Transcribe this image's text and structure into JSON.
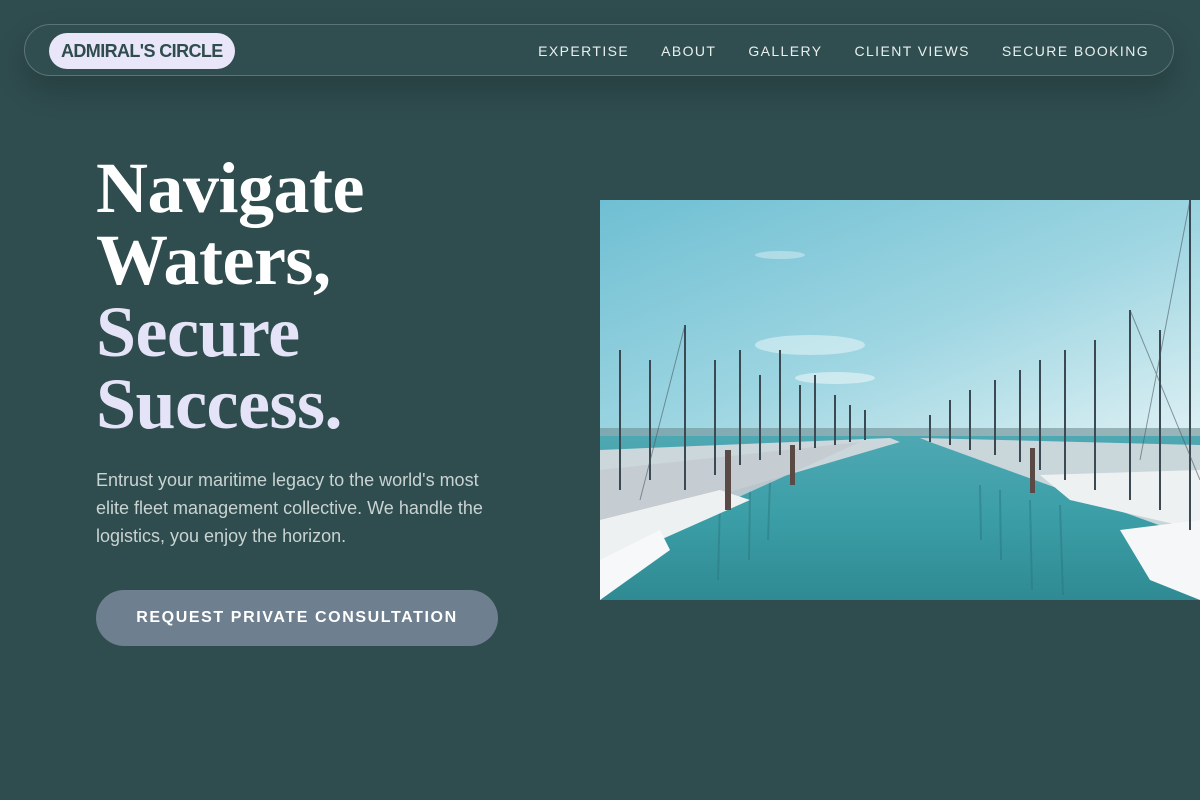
{
  "nav": {
    "brand": "ADMIRAL'S CIRCLE",
    "links": [
      "EXPERTISE",
      "ABOUT",
      "GALLERY",
      "CLIENT VIEWS",
      "SECURE BOOKING"
    ]
  },
  "hero": {
    "title_lines": [
      "Navigate",
      "Waters,",
      "Secure",
      "Success."
    ],
    "body": "Entrust your maritime legacy to the world's most elite fleet management collective. We handle the logistics, you enjoy the horizon.",
    "cta_label": "REQUEST PRIVATE CONSULTATION"
  },
  "colors": {
    "background": "#2f4c4e",
    "brand_pill": "#e8e6f8",
    "accent_lavender": "#e5e3f7",
    "cta": "#6e7f8f"
  }
}
